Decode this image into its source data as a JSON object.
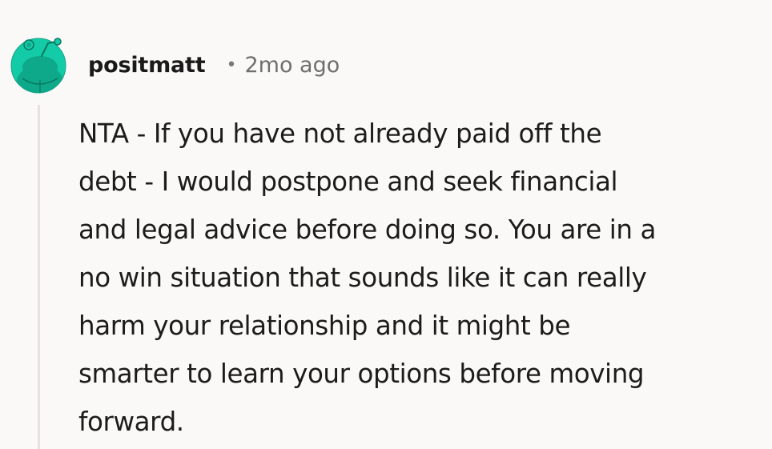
{
  "comment": {
    "username": "positmatt",
    "separator": "•",
    "timestamp": "2mo ago",
    "avatar_icon": "snoo-avatar-icon",
    "body_lines": [
      "NTA - If you have not already paid off the",
      "debt - I would postpone and seek financial",
      "and legal advice before doing so. You are in a",
      "no win situation that sounds like it can really",
      "harm your relationship and it might be",
      "smarter to learn your options before moving",
      "forward."
    ]
  },
  "colors": {
    "background": "#fbf9f7",
    "avatar_teal": "#13c9a6",
    "thread_line": "#e8e1dd"
  }
}
